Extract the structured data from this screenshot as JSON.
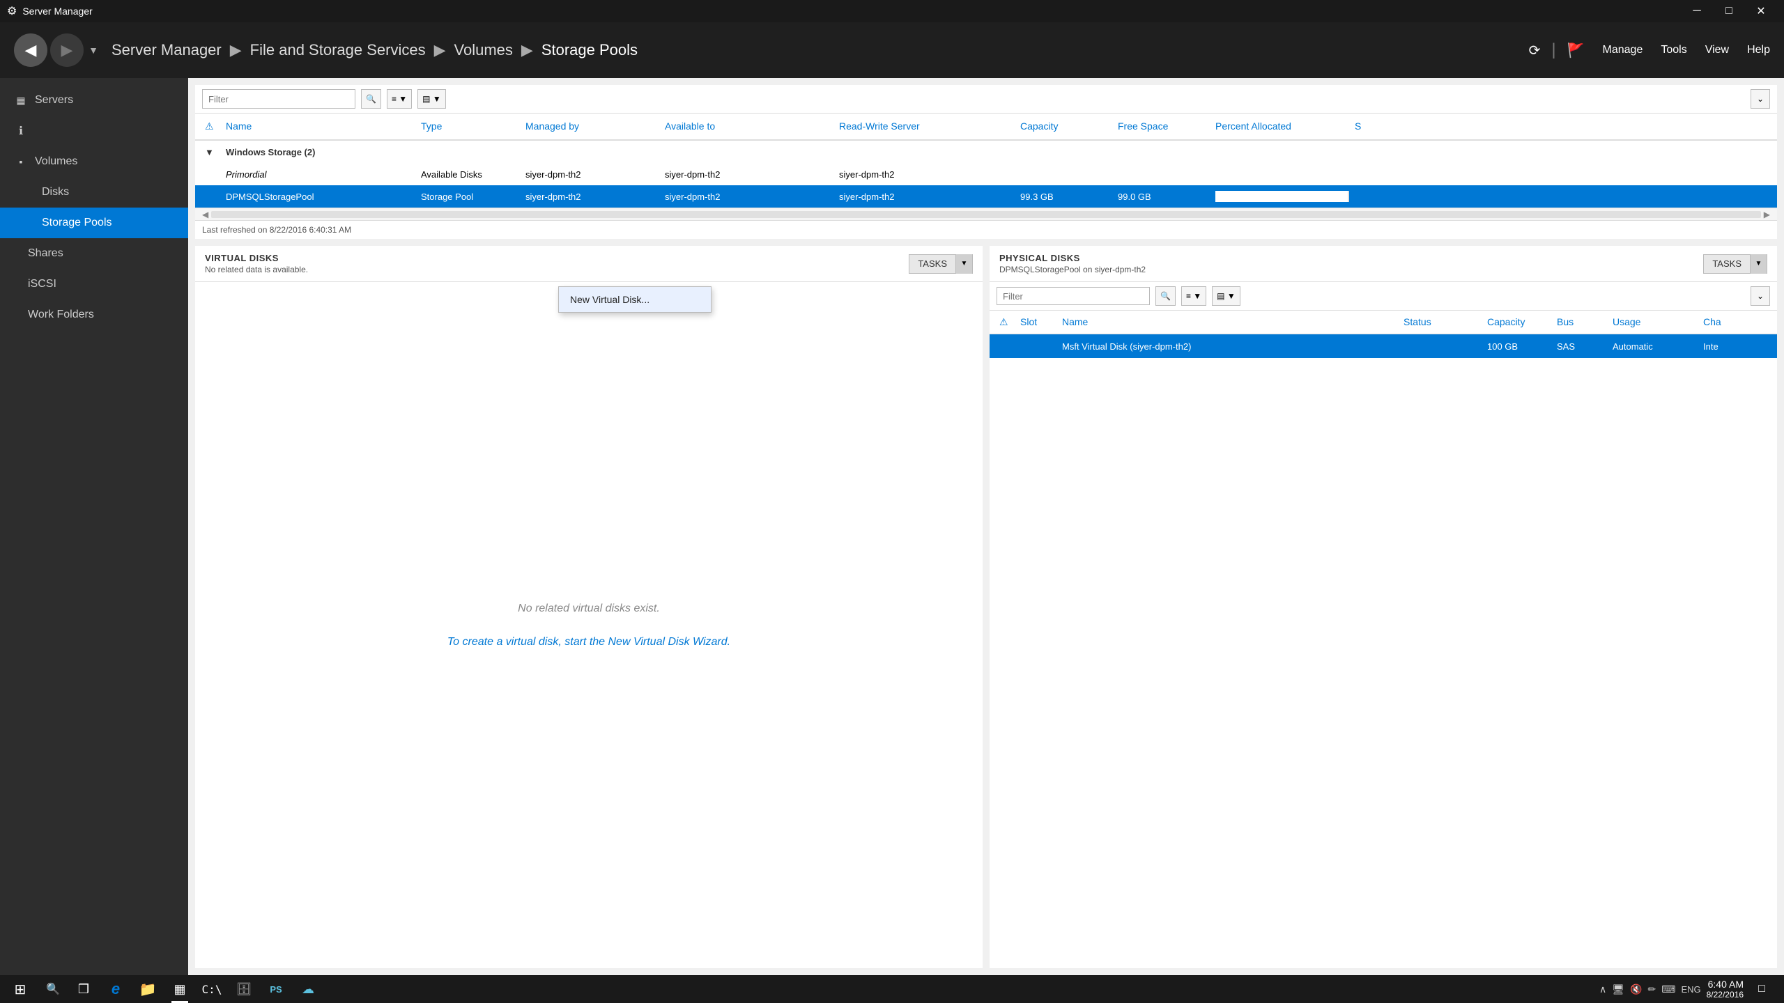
{
  "titlebar": {
    "title": "Server Manager",
    "icon": "⚙"
  },
  "navbar": {
    "breadcrumb": [
      "Server Manager",
      "File and Storage Services",
      "Volumes",
      "Storage Pools"
    ],
    "menu_items": [
      "Manage",
      "Tools",
      "View",
      "Help"
    ]
  },
  "sidebar": {
    "items": [
      {
        "id": "servers",
        "label": "Servers",
        "icon": "▦",
        "active": false
      },
      {
        "id": "dashboard",
        "label": "",
        "icon": "ℹ",
        "active": false
      },
      {
        "id": "volumes",
        "label": "Volumes",
        "icon": "▪",
        "active": false
      },
      {
        "id": "disks",
        "label": "Disks",
        "icon": "",
        "active": false,
        "indent": true
      },
      {
        "id": "storage-pools",
        "label": "Storage Pools",
        "icon": "",
        "active": true,
        "indent": true
      },
      {
        "id": "shares",
        "label": "Shares",
        "icon": "",
        "active": false
      },
      {
        "id": "iscsi",
        "label": "iSCSI",
        "icon": "",
        "active": false
      },
      {
        "id": "work-folders",
        "label": "Work Folders",
        "icon": "",
        "active": false
      }
    ]
  },
  "storage_pools_table": {
    "filter_placeholder": "Filter",
    "columns": [
      "",
      "Name",
      "Type",
      "Managed by",
      "Available to",
      "Read-Write Server",
      "Capacity",
      "Free Space",
      "Percent Allocated",
      "S"
    ],
    "group_label": "Windows Storage (2)",
    "rows": [
      {
        "warning": "",
        "name": "Primordial",
        "type": "Available Disks",
        "managed_by": "siyer-dpm-th2",
        "available_to": "siyer-dpm-th2",
        "rw_server": "siyer-dpm-th2",
        "capacity": "",
        "free_space": "",
        "percent_allocated": "",
        "selected": false,
        "italic": true
      },
      {
        "warning": "",
        "name": "DPMSQLStoragePool",
        "type": "Storage Pool",
        "managed_by": "siyer-dpm-th2",
        "available_to": "siyer-dpm-th2",
        "rw_server": "siyer-dpm-th2",
        "capacity": "99.3 GB",
        "free_space": "99.0 GB",
        "percent_allocated": 99,
        "selected": true,
        "italic": false
      }
    ],
    "last_refreshed": "Last refreshed on 8/22/2016 6:40:31 AM"
  },
  "virtual_disks": {
    "title": "VIRTUAL DISKS",
    "no_data_msg": "No related data is available.",
    "no_data_detail": "No related virtual disks exist.",
    "create_link": "To create a virtual disk, start the New Virtual Disk Wizard.",
    "tasks_label": "TASKS",
    "dropdown_items": [
      "New Virtual Disk..."
    ]
  },
  "physical_disks": {
    "title": "PHYSICAL DISKS",
    "subtitle": "DPMSQLStoragePool on siyer-dpm-th2",
    "tasks_label": "TASKS",
    "filter_placeholder": "Filter",
    "columns": [
      "",
      "Slot",
      "Name",
      "Status",
      "Capacity",
      "Bus",
      "Usage",
      "Cha"
    ],
    "rows": [
      {
        "warning": "",
        "slot": "",
        "name": "Msft Virtual Disk (siyer-dpm-th2)",
        "status": "",
        "capacity": "100 GB",
        "bus": "SAS",
        "usage": "Automatic",
        "chassis": "Inte",
        "selected": true
      }
    ]
  },
  "taskbar": {
    "time": "6:40 AM",
    "date": "8/22/2016",
    "lang": "ENG",
    "apps": [
      {
        "id": "start",
        "icon": "⊞"
      },
      {
        "id": "search",
        "icon": "🔍"
      },
      {
        "id": "task-view",
        "icon": "❐"
      },
      {
        "id": "edge",
        "icon": "e"
      },
      {
        "id": "explorer",
        "icon": "📁"
      },
      {
        "id": "server-manager",
        "icon": "▦",
        "active": true
      },
      {
        "id": "cmd",
        "icon": ">"
      },
      {
        "id": "sql",
        "icon": "🗄"
      },
      {
        "id": "powershell",
        "icon": "PS"
      },
      {
        "id": "azure",
        "icon": "☁"
      }
    ]
  }
}
